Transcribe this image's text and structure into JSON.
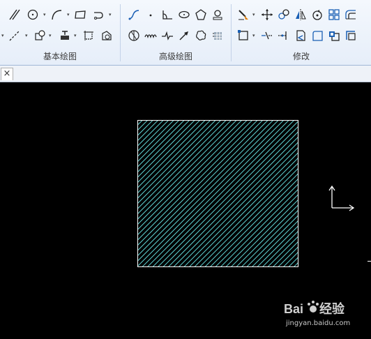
{
  "ribbon": {
    "groups": [
      {
        "label": "基本绘图"
      },
      {
        "label": "高级绘图"
      },
      {
        "label": "修改"
      }
    ]
  },
  "tabbar": {
    "close_label": "×"
  },
  "watermark": {
    "brand": "Bai du 经验",
    "url": "jingyan.baidu.com"
  },
  "colors": {
    "ribbon_bg": "#e6eef9",
    "canvas_bg": "#000000",
    "hatch_color": "#5fd0d0",
    "rect_border": "#ffffff",
    "icon_blue": "#1a5fb4"
  }
}
